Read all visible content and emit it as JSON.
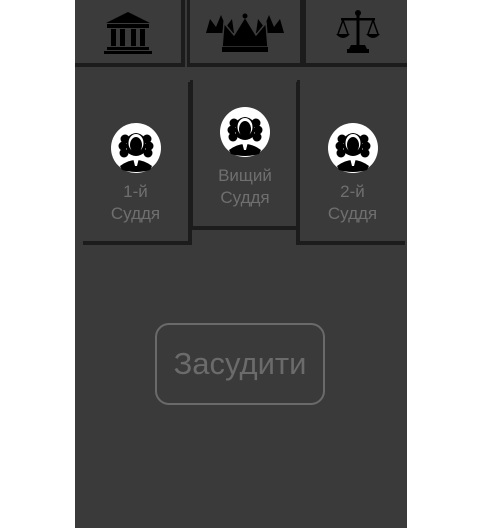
{
  "toolbar": {
    "tabs": [
      {
        "icon": "courthouse-icon"
      },
      {
        "icon": "crowns-icon"
      },
      {
        "icon": "scales-icon"
      }
    ]
  },
  "judges": [
    {
      "label": "1-й\nСуддя",
      "icon": "judge-avatar-icon"
    },
    {
      "label": "Вищий\nСуддя",
      "icon": "judge-avatar-icon"
    },
    {
      "label": "2-й\nСуддя",
      "icon": "judge-avatar-icon"
    }
  ],
  "action": {
    "condemn_label": "Засудити"
  },
  "colors": {
    "background": "#3a3a3a",
    "divider": "#1c1c1c",
    "muted_text": "#6f6f6f"
  }
}
